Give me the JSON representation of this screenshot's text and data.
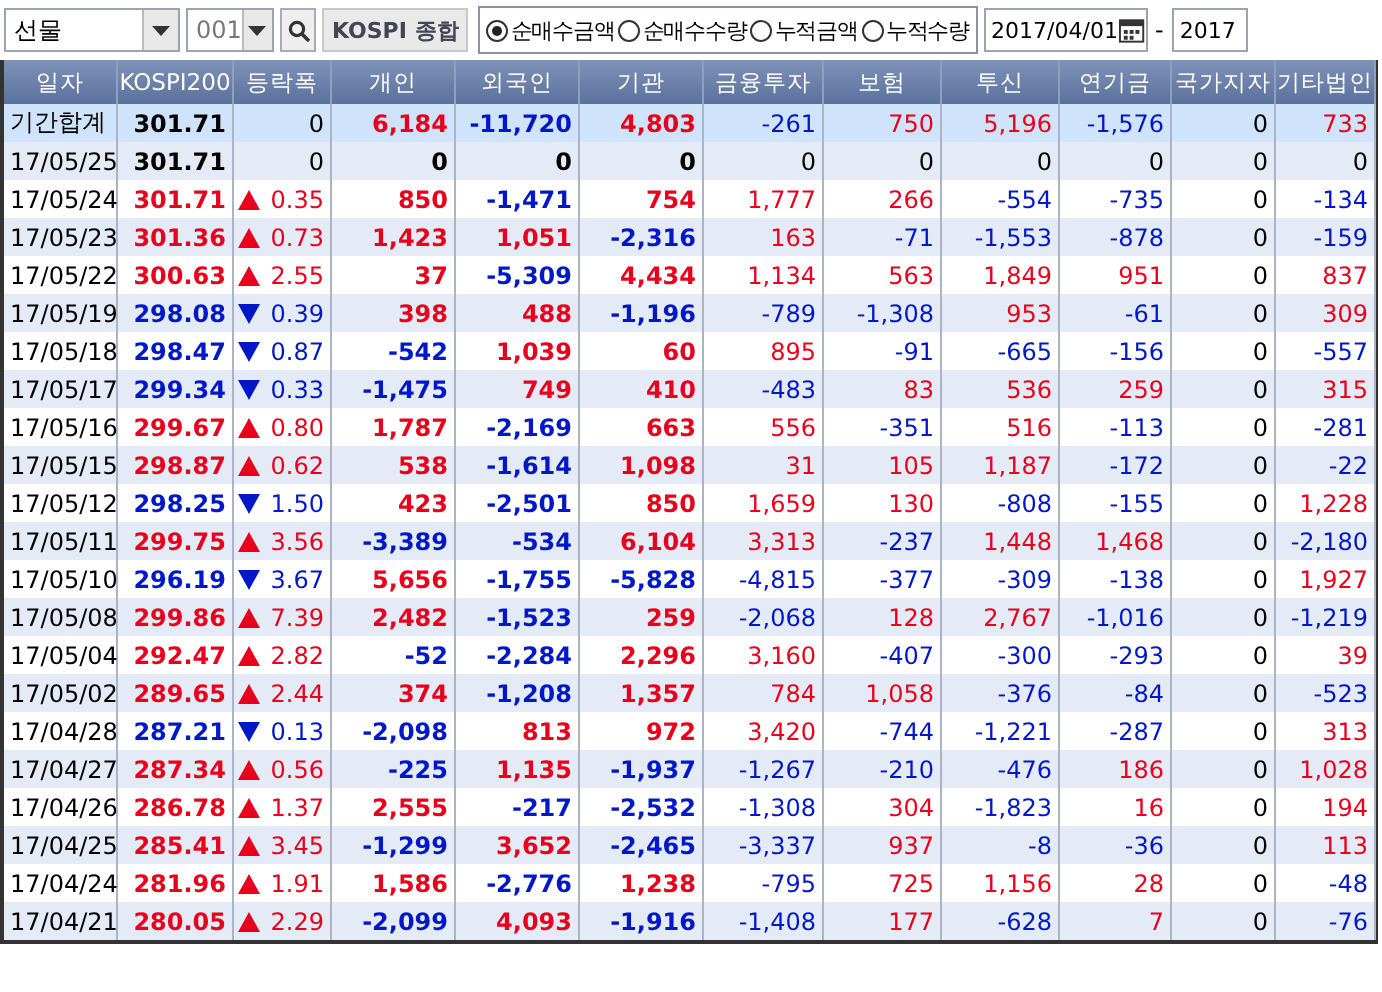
{
  "toolbar": {
    "market": "선물",
    "code": "001",
    "index_name": "KOSPI 종합",
    "radios": [
      {
        "label": "순매수금액",
        "selected": true
      },
      {
        "label": "순매수수량",
        "selected": false
      },
      {
        "label": "누적금액",
        "selected": false
      },
      {
        "label": "누적수량",
        "selected": false
      }
    ],
    "date_from": "2017/04/01",
    "separator": "-",
    "date_to": "2017"
  },
  "table": {
    "columns": [
      "일자",
      "KOSPI200",
      "등락폭",
      "개인",
      "외국인",
      "기관",
      "금융투자",
      "보험",
      "투신",
      "연기금",
      "국가지자",
      "기타법인"
    ],
    "rows": [
      {
        "kind": "summary",
        "date": "기간합계",
        "kospi": "301.71",
        "up": false,
        "down": false,
        "change": "0",
        "values": [
          "6,184",
          "-11,720",
          "4,803",
          "-261",
          "750",
          "5,196",
          "-1,576",
          "0",
          "733"
        ]
      },
      {
        "kind": "day",
        "date": "17/05/25",
        "kospi": "301.71",
        "up": false,
        "down": false,
        "change": "0",
        "values": [
          "0",
          "0",
          "0",
          "0",
          "0",
          "0",
          "0",
          "0",
          "0"
        ]
      },
      {
        "kind": "day",
        "date": "17/05/24",
        "kospi": "301.71",
        "up": true,
        "down": false,
        "change": "0.35",
        "values": [
          "850",
          "-1,471",
          "754",
          "1,777",
          "266",
          "-554",
          "-735",
          "0",
          "-134"
        ]
      },
      {
        "kind": "day",
        "date": "17/05/23",
        "kospi": "301.36",
        "up": true,
        "down": false,
        "change": "0.73",
        "values": [
          "1,423",
          "1,051",
          "-2,316",
          "163",
          "-71",
          "-1,553",
          "-878",
          "0",
          "-159"
        ]
      },
      {
        "kind": "day",
        "date": "17/05/22",
        "kospi": "300.63",
        "up": true,
        "down": false,
        "change": "2.55",
        "values": [
          "37",
          "-5,309",
          "4,434",
          "1,134",
          "563",
          "1,849",
          "951",
          "0",
          "837"
        ]
      },
      {
        "kind": "day",
        "date": "17/05/19",
        "kospi": "298.08",
        "up": false,
        "down": true,
        "change": "0.39",
        "values": [
          "398",
          "488",
          "-1,196",
          "-789",
          "-1,308",
          "953",
          "-61",
          "0",
          "309"
        ]
      },
      {
        "kind": "day",
        "date": "17/05/18",
        "kospi": "298.47",
        "up": false,
        "down": true,
        "change": "0.87",
        "values": [
          "-542",
          "1,039",
          "60",
          "895",
          "-91",
          "-665",
          "-156",
          "0",
          "-557"
        ]
      },
      {
        "kind": "day",
        "date": "17/05/17",
        "kospi": "299.34",
        "up": false,
        "down": true,
        "change": "0.33",
        "values": [
          "-1,475",
          "749",
          "410",
          "-483",
          "83",
          "536",
          "259",
          "0",
          "315"
        ]
      },
      {
        "kind": "day",
        "date": "17/05/16",
        "kospi": "299.67",
        "up": true,
        "down": false,
        "change": "0.80",
        "values": [
          "1,787",
          "-2,169",
          "663",
          "556",
          "-351",
          "516",
          "-113",
          "0",
          "-281"
        ]
      },
      {
        "kind": "day",
        "date": "17/05/15",
        "kospi": "298.87",
        "up": true,
        "down": false,
        "change": "0.62",
        "values": [
          "538",
          "-1,614",
          "1,098",
          "31",
          "105",
          "1,187",
          "-172",
          "0",
          "-22"
        ]
      },
      {
        "kind": "day",
        "date": "17/05/12",
        "kospi": "298.25",
        "up": false,
        "down": true,
        "change": "1.50",
        "values": [
          "423",
          "-2,501",
          "850",
          "1,659",
          "130",
          "-808",
          "-155",
          "0",
          "1,228"
        ]
      },
      {
        "kind": "day",
        "date": "17/05/11",
        "kospi": "299.75",
        "up": true,
        "down": false,
        "change": "3.56",
        "values": [
          "-3,389",
          "-534",
          "6,104",
          "3,313",
          "-237",
          "1,448",
          "1,468",
          "0",
          "-2,180"
        ]
      },
      {
        "kind": "day",
        "date": "17/05/10",
        "kospi": "296.19",
        "up": false,
        "down": true,
        "change": "3.67",
        "values": [
          "5,656",
          "-1,755",
          "-5,828",
          "-4,815",
          "-377",
          "-309",
          "-138",
          "0",
          "1,927"
        ]
      },
      {
        "kind": "day",
        "date": "17/05/08",
        "kospi": "299.86",
        "up": true,
        "down": false,
        "change": "7.39",
        "values": [
          "2,482",
          "-1,523",
          "259",
          "-2,068",
          "128",
          "2,767",
          "-1,016",
          "0",
          "-1,219"
        ]
      },
      {
        "kind": "day",
        "date": "17/05/04",
        "kospi": "292.47",
        "up": true,
        "down": false,
        "change": "2.82",
        "values": [
          "-52",
          "-2,284",
          "2,296",
          "3,160",
          "-407",
          "-300",
          "-293",
          "0",
          "39"
        ]
      },
      {
        "kind": "day",
        "date": "17/05/02",
        "kospi": "289.65",
        "up": true,
        "down": false,
        "change": "2.44",
        "values": [
          "374",
          "-1,208",
          "1,357",
          "784",
          "1,058",
          "-376",
          "-84",
          "0",
          "-523"
        ]
      },
      {
        "kind": "day",
        "date": "17/04/28",
        "kospi": "287.21",
        "up": false,
        "down": true,
        "change": "0.13",
        "values": [
          "-2,098",
          "813",
          "972",
          "3,420",
          "-744",
          "-1,221",
          "-287",
          "0",
          "313"
        ]
      },
      {
        "kind": "day",
        "date": "17/04/27",
        "kospi": "287.34",
        "up": true,
        "down": false,
        "change": "0.56",
        "values": [
          "-225",
          "1,135",
          "-1,937",
          "-1,267",
          "-210",
          "-476",
          "186",
          "0",
          "1,028"
        ]
      },
      {
        "kind": "day",
        "date": "17/04/26",
        "kospi": "286.78",
        "up": true,
        "down": false,
        "change": "1.37",
        "values": [
          "2,555",
          "-217",
          "-2,532",
          "-1,308",
          "304",
          "-1,823",
          "16",
          "0",
          "194"
        ]
      },
      {
        "kind": "day",
        "date": "17/04/25",
        "kospi": "285.41",
        "up": true,
        "down": false,
        "change": "3.45",
        "values": [
          "-1,299",
          "3,652",
          "-2,465",
          "-3,337",
          "937",
          "-8",
          "-36",
          "0",
          "113"
        ]
      },
      {
        "kind": "day",
        "date": "17/04/24",
        "kospi": "281.96",
        "up": true,
        "down": false,
        "change": "1.91",
        "values": [
          "1,586",
          "-2,776",
          "1,238",
          "-795",
          "725",
          "1,156",
          "28",
          "0",
          "-48"
        ]
      },
      {
        "kind": "day",
        "date": "17/04/21",
        "kospi": "280.05",
        "up": true,
        "down": false,
        "change": "2.29",
        "values": [
          "-2,099",
          "4,093",
          "-1,916",
          "-1,408",
          "177",
          "-628",
          "7",
          "0",
          "-76"
        ]
      }
    ]
  }
}
